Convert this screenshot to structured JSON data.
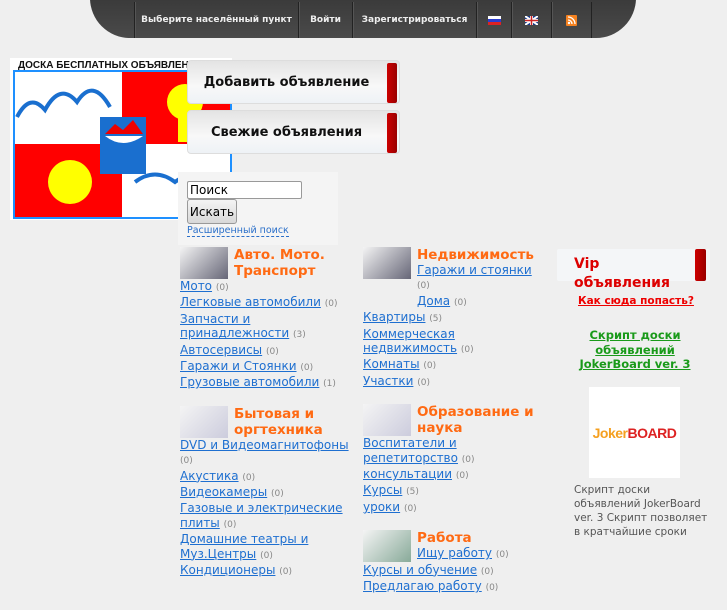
{
  "nav": {
    "location": "Выберите населённый пункт",
    "login": "Войти",
    "register": "Зарегистрироваться",
    "lang_ru": "ru-flag-icon",
    "lang_en": "uk-flag-icon",
    "rss": "rss-icon"
  },
  "logo": {
    "title": "ДОСКА БЕСПЛАТНЫХ ОБЪЯВЛЕНИЙ"
  },
  "buttons": {
    "add": "Добавить объявление",
    "fresh": "Свежие объявления"
  },
  "search": {
    "value": "Поиск",
    "button": "Искать",
    "advanced": "Расширенный поиск"
  },
  "categories_left": [
    {
      "title": "Авто. Мото. Транспорт",
      "items": [
        {
          "label": "Мото",
          "count": "(0)"
        },
        {
          "label": "Легковые автомобили",
          "count": "(0)"
        },
        {
          "label": "Запчасти и принадлежности",
          "count": "(3)"
        },
        {
          "label": "Автосервисы",
          "count": "(0)"
        },
        {
          "label": "Гаражи и Стоянки",
          "count": "(0)"
        },
        {
          "label": "Грузовые автомобили",
          "count": "(1)"
        }
      ]
    },
    {
      "title": "Бытовая и оргтехника",
      "items": [
        {
          "label": "DVD и Видеомагнитофоны",
          "count": "(0)"
        },
        {
          "label": "Акустика",
          "count": "(0)"
        },
        {
          "label": "Видеокамеры",
          "count": "(0)"
        },
        {
          "label": "Газовые и электрические плиты",
          "count": "(0)"
        },
        {
          "label": "Домашние театры и Муз.Центры",
          "count": "(0)"
        },
        {
          "label": "Кондиционеры",
          "count": "(0)"
        }
      ]
    }
  ],
  "categories_mid": [
    {
      "title": "Недвижимость",
      "items": [
        {
          "label": "Гаражи и стоянки",
          "count": "(0)"
        },
        {
          "label": "Дома",
          "count": "(0)"
        },
        {
          "label": "Квартиры",
          "count": "(5)"
        },
        {
          "label": "Коммерческая недвижимость",
          "count": "(0)"
        },
        {
          "label": "Комнаты",
          "count": "(0)"
        },
        {
          "label": "Участки",
          "count": "(0)"
        }
      ]
    },
    {
      "title": "Образование и наука",
      "items": [
        {
          "label": "Воспитатели и репетиторство",
          "count": "(0)"
        },
        {
          "label": "консультации",
          "count": "(0)"
        },
        {
          "label": "Курсы",
          "count": "(5)"
        },
        {
          "label": "уроки",
          "count": "(0)"
        }
      ]
    },
    {
      "title": "Работа",
      "items": [
        {
          "label": "Ищу работу",
          "count": "(0)"
        },
        {
          "label": "Курсы и обучение",
          "count": "(0)"
        },
        {
          "label": "Предлагаю работу",
          "count": "(0)"
        }
      ]
    }
  ],
  "vip": {
    "title": "Vip объявления",
    "how": "Как сюда попасть?",
    "script_link": "Скрипт доски объявлений JokerBoard ver. 3",
    "logo_text": "JokerBOARD",
    "desc": "Скрипт доски объявлений JokerBoard ver. 3 Скрипт позволяет в кратчайшие сроки"
  }
}
